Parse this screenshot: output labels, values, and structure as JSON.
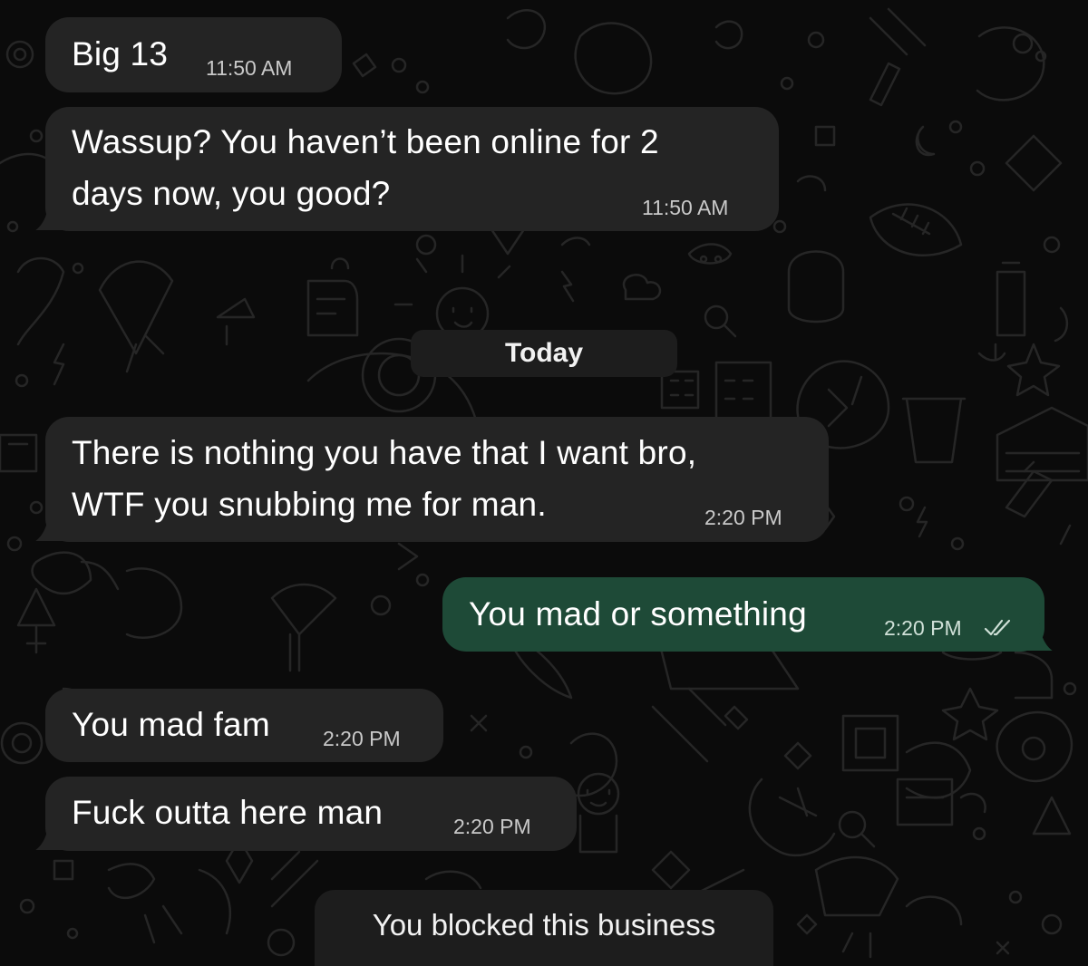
{
  "messages": [
    {
      "direction": "incoming",
      "lines": [
        "Big 13"
      ],
      "time": "11:50 AM"
    },
    {
      "direction": "incoming",
      "lines": [
        "Wassup? You haven’t been online for 2",
        "days now, you good?"
      ],
      "time": "11:50 AM"
    },
    {
      "direction": "incoming",
      "lines": [
        "There is nothing you have that I want bro,",
        "WTF you snubbing me for man."
      ],
      "time": "2:20 PM"
    },
    {
      "direction": "outgoing",
      "lines": [
        "You mad or something"
      ],
      "time": "2:20 PM",
      "status_icon": "double-check-icon"
    },
    {
      "direction": "incoming",
      "lines": [
        "You mad fam"
      ],
      "time": "2:20 PM"
    },
    {
      "direction": "incoming",
      "lines": [
        "Fuck outta here man"
      ],
      "time": "2:20 PM"
    }
  ],
  "date_separator": "Today",
  "system_notice": "You blocked this business",
  "colors": {
    "background": "#0b0b0b",
    "incoming_bubble": "#242424",
    "outgoing_bubble": "#1e4a37",
    "text": "#ffffff",
    "timestamp": "#c9c9c9"
  }
}
